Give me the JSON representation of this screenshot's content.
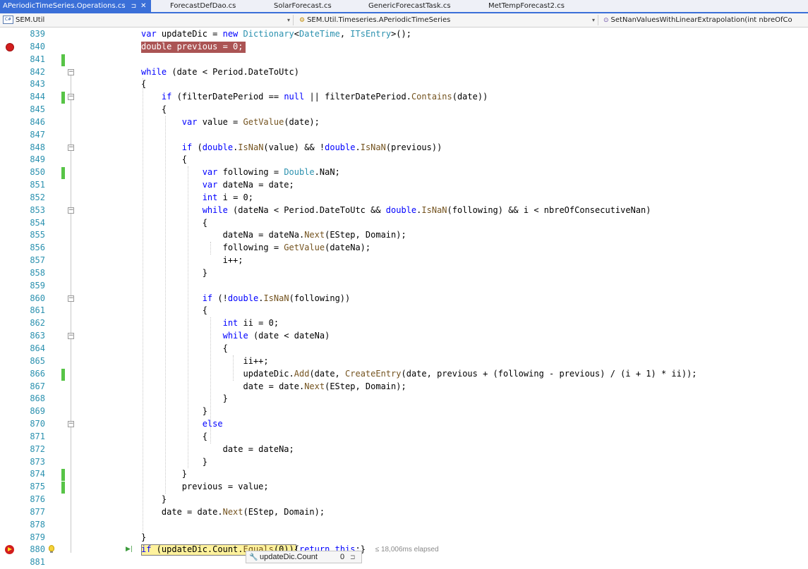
{
  "tabs": [
    {
      "label": "APeriodicTimeSeries.Operations.cs",
      "active": true
    },
    {
      "label": "ForecastDefDao.cs"
    },
    {
      "label": "SolarForecast.cs"
    },
    {
      "label": "GenericForecastTask.cs"
    },
    {
      "label": "MetTempForecast2.cs"
    }
  ],
  "tab_pin_glyph": "⊐",
  "tab_close_glyph": "✕",
  "navbar": {
    "project": "SEM.Util",
    "project_icon_text": "C#",
    "type": "SEM.Util.Timeseries.APeriodicTimeSeries",
    "member": "SetNanValuesWithLinearExtrapolation(int nbreOfCo"
  },
  "colors": {
    "accent": "#3a6fd8",
    "keyword": "#0000ff",
    "type": "#2b91af",
    "method": "#74531f",
    "line_number": "#2b91af",
    "breakpoint": "#d21d1d",
    "change_bar": "#57c447",
    "exec_highlight": "#fff29c"
  },
  "code_lines": [
    {
      "n": "839",
      "tokens": [
        [
          "var",
          "kw"
        ],
        [
          " updateDic = "
        ],
        [
          "new",
          "kw"
        ],
        [
          " "
        ],
        [
          "Dictionary",
          "ty"
        ],
        [
          "<"
        ],
        [
          "DateTime",
          "ty"
        ],
        [
          ", "
        ],
        [
          "ITsEntry",
          "ty"
        ],
        [
          ">();"
        ]
      ]
    },
    {
      "n": "840",
      "breakpoint": true,
      "tokens": [
        [
          "double previous = 0;",
          "bp"
        ]
      ]
    },
    {
      "n": "841",
      "changed": true,
      "tokens": []
    },
    {
      "n": "842",
      "fold": true,
      "tokens": [
        [
          "while",
          "kw"
        ],
        [
          " (date < Period.DateToUtc)"
        ]
      ]
    },
    {
      "n": "843",
      "tokens": [
        [
          "{"
        ]
      ]
    },
    {
      "n": "844",
      "changed": true,
      "fold": true,
      "tokens": [
        [
          "    "
        ],
        [
          "if",
          "kw"
        ],
        [
          " (filterDatePeriod == "
        ],
        [
          "null",
          "kw"
        ],
        [
          " || filterDatePeriod."
        ],
        [
          "Contains",
          "mt"
        ],
        [
          "(date))"
        ]
      ]
    },
    {
      "n": "845",
      "tokens": [
        [
          "    {"
        ]
      ]
    },
    {
      "n": "846",
      "tokens": [
        [
          "        "
        ],
        [
          "var",
          "kw"
        ],
        [
          " value = "
        ],
        [
          "GetValue",
          "mt"
        ],
        [
          "(date);"
        ]
      ]
    },
    {
      "n": "847",
      "tokens": []
    },
    {
      "n": "848",
      "fold": true,
      "tokens": [
        [
          "        "
        ],
        [
          "if",
          "kw"
        ],
        [
          " ("
        ],
        [
          "double",
          "kw"
        ],
        [
          "."
        ],
        [
          "IsNaN",
          "mt"
        ],
        [
          "(value) && !"
        ],
        [
          "double",
          "kw"
        ],
        [
          "."
        ],
        [
          "IsNaN",
          "mt"
        ],
        [
          "(previous))"
        ]
      ]
    },
    {
      "n": "849",
      "tokens": [
        [
          "        {"
        ]
      ]
    },
    {
      "n": "850",
      "changed": true,
      "tokens": [
        [
          "            "
        ],
        [
          "var",
          "kw"
        ],
        [
          " following = "
        ],
        [
          "Double",
          "ty"
        ],
        [
          ".NaN;"
        ]
      ]
    },
    {
      "n": "851",
      "tokens": [
        [
          "            "
        ],
        [
          "var",
          "kw"
        ],
        [
          " dateNa = date;"
        ]
      ]
    },
    {
      "n": "852",
      "tokens": [
        [
          "            "
        ],
        [
          "int",
          "kw"
        ],
        [
          " i = 0;"
        ]
      ]
    },
    {
      "n": "853",
      "fold": true,
      "tokens": [
        [
          "            "
        ],
        [
          "while",
          "kw"
        ],
        [
          " (dateNa < Period.DateToUtc && "
        ],
        [
          "double",
          "kw"
        ],
        [
          "."
        ],
        [
          "IsNaN",
          "mt"
        ],
        [
          "(following) && i < nbreOfConsecutiveNan)"
        ]
      ]
    },
    {
      "n": "854",
      "tokens": [
        [
          "            {"
        ]
      ]
    },
    {
      "n": "855",
      "tokens": [
        [
          "                dateNa = dateNa."
        ],
        [
          "Next",
          "mt"
        ],
        [
          "(EStep, Domain);"
        ]
      ]
    },
    {
      "n": "856",
      "tokens": [
        [
          "                following = "
        ],
        [
          "GetValue",
          "mt"
        ],
        [
          "(dateNa);"
        ]
      ]
    },
    {
      "n": "857",
      "tokens": [
        [
          "                i++;"
        ]
      ]
    },
    {
      "n": "858",
      "tokens": [
        [
          "            }"
        ]
      ]
    },
    {
      "n": "859",
      "tokens": []
    },
    {
      "n": "860",
      "fold": true,
      "tokens": [
        [
          "            "
        ],
        [
          "if",
          "kw"
        ],
        [
          " (!"
        ],
        [
          "double",
          "kw"
        ],
        [
          "."
        ],
        [
          "IsNaN",
          "mt"
        ],
        [
          "(following))"
        ]
      ]
    },
    {
      "n": "861",
      "tokens": [
        [
          "            {"
        ]
      ]
    },
    {
      "n": "862",
      "tokens": [
        [
          "                "
        ],
        [
          "int",
          "kw"
        ],
        [
          " ii = 0;"
        ]
      ]
    },
    {
      "n": "863",
      "fold": true,
      "tokens": [
        [
          "                "
        ],
        [
          "while",
          "kw"
        ],
        [
          " (date < dateNa)"
        ]
      ]
    },
    {
      "n": "864",
      "tokens": [
        [
          "                {"
        ]
      ]
    },
    {
      "n": "865",
      "tokens": [
        [
          "                    ii++;"
        ]
      ]
    },
    {
      "n": "866",
      "changed": true,
      "tokens": [
        [
          "                    updateDic."
        ],
        [
          "Add",
          "mt"
        ],
        [
          "(date, "
        ],
        [
          "CreateEntry",
          "mt"
        ],
        [
          "(date, previous + (following - previous) / (i + 1) * ii));"
        ]
      ]
    },
    {
      "n": "867",
      "tokens": [
        [
          "                    date = date."
        ],
        [
          "Next",
          "mt"
        ],
        [
          "(EStep, Domain);"
        ]
      ]
    },
    {
      "n": "868",
      "tokens": [
        [
          "                }"
        ]
      ]
    },
    {
      "n": "869",
      "tokens": [
        [
          "            }"
        ]
      ]
    },
    {
      "n": "870",
      "fold": true,
      "tokens": [
        [
          "            "
        ],
        [
          "else",
          "kw"
        ]
      ]
    },
    {
      "n": "871",
      "tokens": [
        [
          "            {"
        ]
      ]
    },
    {
      "n": "872",
      "tokens": [
        [
          "                date = dateNa;"
        ]
      ]
    },
    {
      "n": "873",
      "tokens": [
        [
          "            }"
        ]
      ]
    },
    {
      "n": "874",
      "changed": true,
      "tokens": [
        [
          "        }"
        ]
      ]
    },
    {
      "n": "875",
      "changed": true,
      "tokens": [
        [
          "        previous = value;"
        ]
      ]
    },
    {
      "n": "876",
      "tokens": [
        [
          "    }"
        ]
      ]
    },
    {
      "n": "877",
      "tokens": [
        [
          "    date = date."
        ],
        [
          "Next",
          "mt"
        ],
        [
          "(EStep, Domain);"
        ]
      ]
    },
    {
      "n": "878",
      "tokens": []
    },
    {
      "n": "879",
      "tokens": [
        [
          "}"
        ]
      ]
    },
    {
      "n": "880",
      "current": true,
      "tokens": [
        [
          "if",
          "kw"
        ],
        [
          " (updateDic.Count."
        ],
        [
          "Equals",
          "mt"
        ],
        [
          "(0))"
        ],
        [
          "{"
        ],
        [
          "return",
          "kw"
        ],
        [
          " "
        ],
        [
          "this",
          "kw"
        ],
        [
          ";}"
        ]
      ]
    },
    {
      "n": "881",
      "tokens": []
    }
  ],
  "current_line": {
    "elapsed": "≤ 18,006ms elapsed"
  },
  "datatip": {
    "expression": "updateDic.Count",
    "value": "0",
    "pin_glyph": "⊐"
  }
}
